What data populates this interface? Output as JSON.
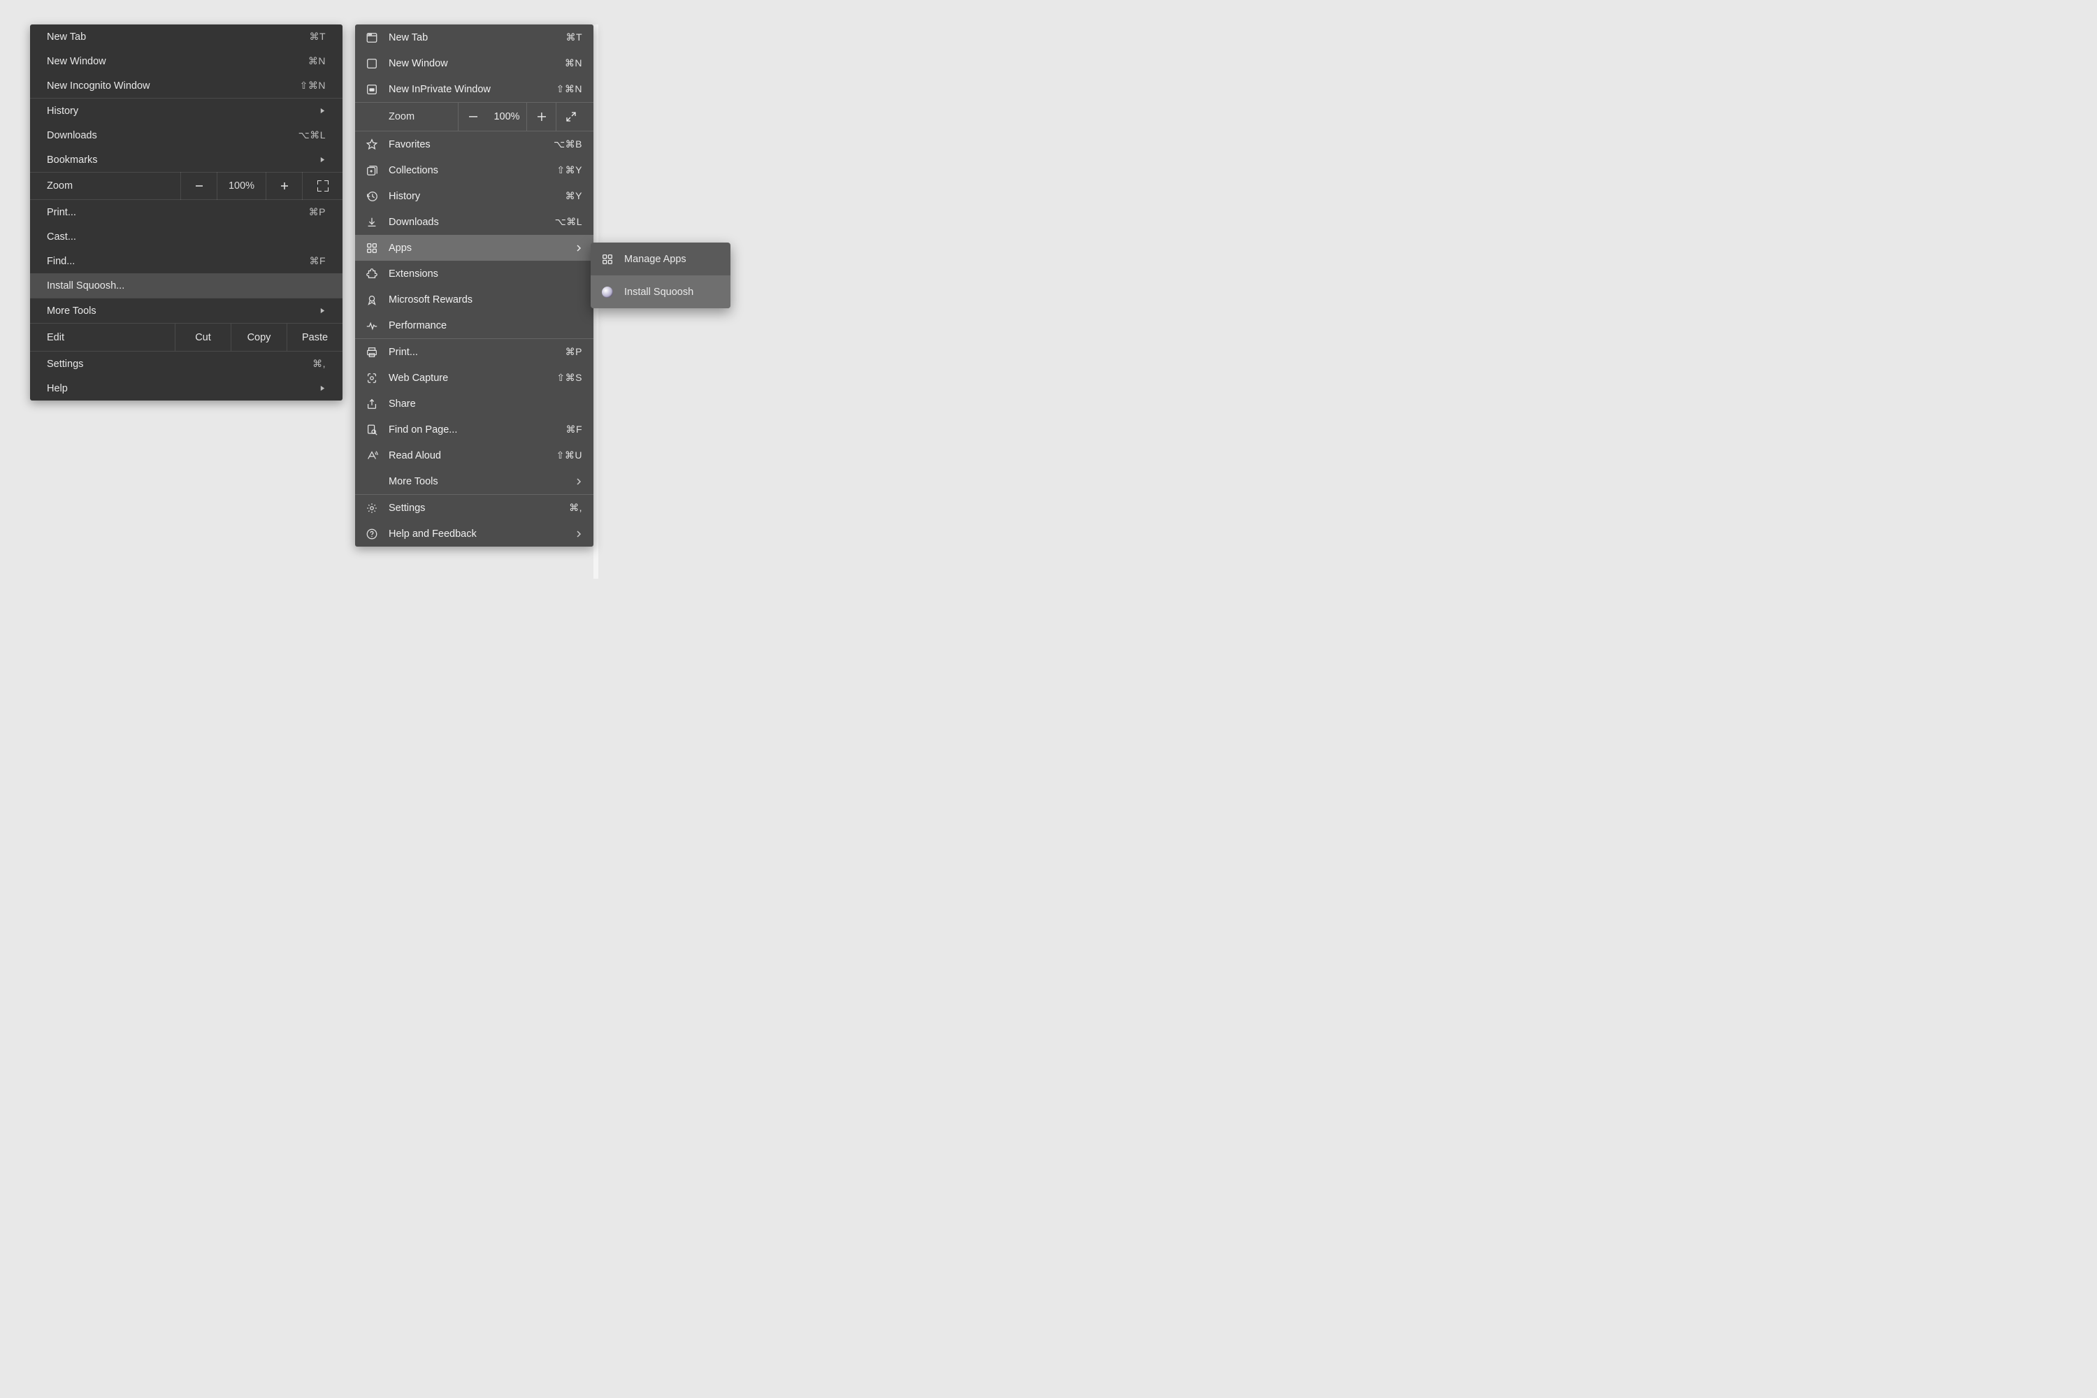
{
  "chrome": {
    "new_tab": "New Tab",
    "new_tab_sc": "⌘T",
    "new_window": "New Window",
    "new_window_sc": "⌘N",
    "new_incognito": "New Incognito Window",
    "new_incognito_sc": "⇧⌘N",
    "history": "History",
    "downloads": "Downloads",
    "downloads_sc": "⌥⌘L",
    "bookmarks": "Bookmarks",
    "zoom_label": "Zoom",
    "zoom_value": "100%",
    "print": "Print...",
    "print_sc": "⌘P",
    "cast": "Cast...",
    "find": "Find...",
    "find_sc": "⌘F",
    "install": "Install Squoosh...",
    "more_tools": "More Tools",
    "edit": "Edit",
    "cut": "Cut",
    "copy": "Copy",
    "paste": "Paste",
    "settings": "Settings",
    "settings_sc": "⌘,",
    "help": "Help"
  },
  "edge": {
    "new_tab": "New Tab",
    "new_tab_sc": "⌘T",
    "new_window": "New Window",
    "new_window_sc": "⌘N",
    "new_inprivate": "New InPrivate Window",
    "new_inprivate_sc": "⇧⌘N",
    "zoom_label": "Zoom",
    "zoom_value": "100%",
    "favorites": "Favorites",
    "favorites_sc": "⌥⌘B",
    "collections": "Collections",
    "collections_sc": "⇧⌘Y",
    "history": "History",
    "history_sc": "⌘Y",
    "downloads": "Downloads",
    "downloads_sc": "⌥⌘L",
    "apps": "Apps",
    "extensions": "Extensions",
    "rewards": "Microsoft Rewards",
    "performance": "Performance",
    "print": "Print...",
    "print_sc": "⌘P",
    "web_capture": "Web Capture",
    "web_capture_sc": "⇧⌘S",
    "share": "Share",
    "find_on_page": "Find on Page...",
    "find_on_page_sc": "⌘F",
    "read_aloud": "Read Aloud",
    "read_aloud_sc": "⇧⌘U",
    "more_tools": "More Tools",
    "settings": "Settings",
    "settings_sc": "⌘,",
    "help": "Help and Feedback"
  },
  "edge_sub": {
    "manage_apps": "Manage Apps",
    "install": "Install Squoosh"
  }
}
